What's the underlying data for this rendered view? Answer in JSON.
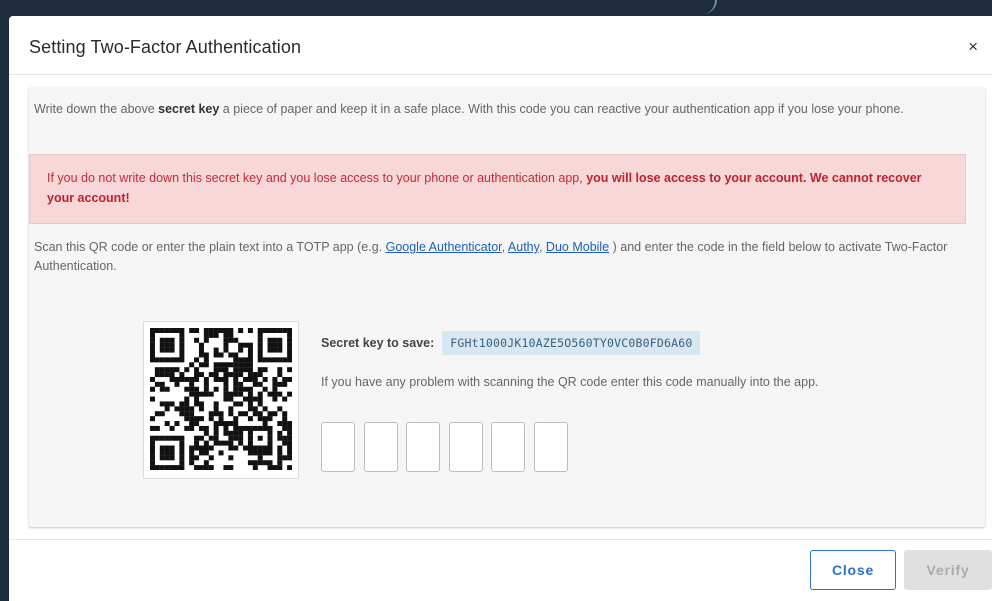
{
  "modal": {
    "title": "Setting Two-Factor Authentication",
    "close_glyph": "×"
  },
  "intro": {
    "before": "Write down the above ",
    "bold": "secret key",
    "after": " a piece of paper and keep it in a safe place. With this code you can reactive your authentication app if you lose your phone."
  },
  "alert": {
    "text": "If you do not write down this secret key and you lose access to your phone or authentication app, ",
    "bold": "you will lose access to your account. We cannot recover your account!"
  },
  "scan": {
    "before": "Scan this QR code or enter the plain text into a TOTP app (e.g. ",
    "links": [
      "Google Authenticator",
      "Authy",
      "Duo Mobile"
    ],
    "sep1": ", ",
    "sep2": ", ",
    "after": " ) and enter the code in the field below to activate Two-Factor Authentication."
  },
  "secret": {
    "label": "Secret key to save:",
    "value": "FGHt1000JK10AZE5O560TY0VC0B0FD6A60"
  },
  "manual_text": "If you have any problem with scanning the QR code enter this code manually into the app.",
  "code_inputs": [
    "",
    "",
    "",
    "",
    "",
    ""
  ],
  "buttons": {
    "close": "Close",
    "verify": "Verify"
  },
  "colors": {
    "primary": "#2b70c9",
    "alert_bg": "#f8d7d9",
    "alert_text": "#c52a36",
    "key_bg": "#d7e8f2"
  }
}
